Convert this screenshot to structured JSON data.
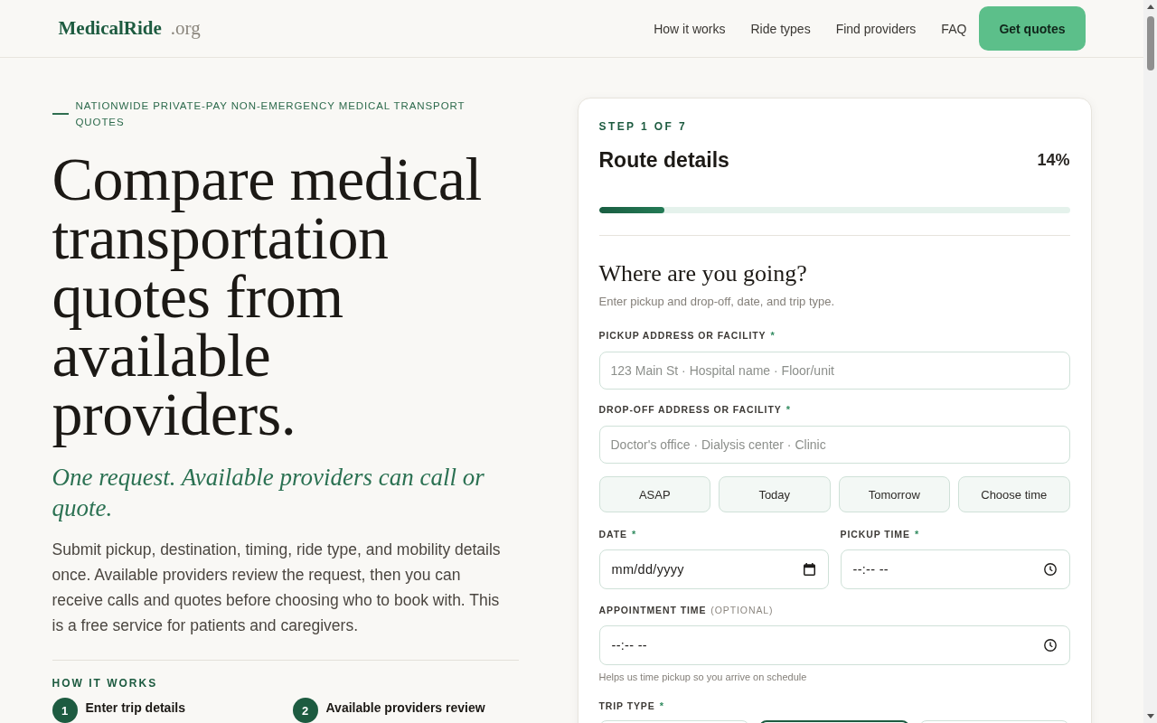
{
  "header": {
    "logo": {
      "name": "MedicalRide",
      "suffix": ".org"
    },
    "nav": [
      "How it works",
      "Ride types",
      "Find providers",
      "FAQ"
    ],
    "cta": "Get quotes"
  },
  "hero": {
    "eyebrow": "NATIONWIDE PRIVATE-PAY NON-EMERGENCY MEDICAL TRANSPORT QUOTES",
    "title": "Compare medical transportation quotes from available providers.",
    "tagline": "One request. Available providers can call or quote.",
    "description": "Submit pickup, destination, timing, ride type, and mobility details once. Available providers review the request, then you can receive calls and quotes before choosing who to book with. This is a free service for patients and caregivers.",
    "how_it_works": {
      "heading": "HOW IT WORKS",
      "steps": [
        {
          "number": "1",
          "title": "Enter trip details"
        },
        {
          "number": "2",
          "title": "Available providers review"
        }
      ]
    }
  },
  "form": {
    "step": "STEP 1 OF 7",
    "title": "Route details",
    "percent": "14%",
    "progress": {
      "level": 0.14
    },
    "heading": "Where are you going?",
    "subtitle": "Enter pickup and drop-off, date, and trip type.",
    "pickup": {
      "kind": "text",
      "label": "PICKUP ADDRESS OR FACILITY",
      "required_mark": "*",
      "placeholder": "123 Main St · Hospital name · Floor/unit"
    },
    "dropoff": {
      "kind": "text",
      "label": "DROP-OFF ADDRESS OR FACILITY",
      "required_mark": "*",
      "placeholder": "Doctor's office · Dialysis center · Clinic"
    },
    "quick_times": [
      "ASAP",
      "Today",
      "Tomorrow",
      "Choose time"
    ],
    "date": {
      "kind": "date",
      "label": "DATE",
      "required_mark": "*",
      "placeholder": "mm/dd/yyyy"
    },
    "pickup_time": {
      "kind": "time",
      "label": "PICKUP TIME",
      "required_mark": "*",
      "placeholder": "--:-- --"
    },
    "appointment_time": {
      "kind": "time",
      "label": "APPOINTMENT TIME",
      "note": "(OPTIONAL)",
      "placeholder": "--:-- --",
      "hint": "Helps us time pickup so you arrive on schedule"
    },
    "trip_type": {
      "label": "TRIP TYPE",
      "required_mark": "*",
      "options": [
        {
          "selected": false
        },
        {
          "selected": true
        },
        {
          "selected": false
        }
      ]
    }
  }
}
